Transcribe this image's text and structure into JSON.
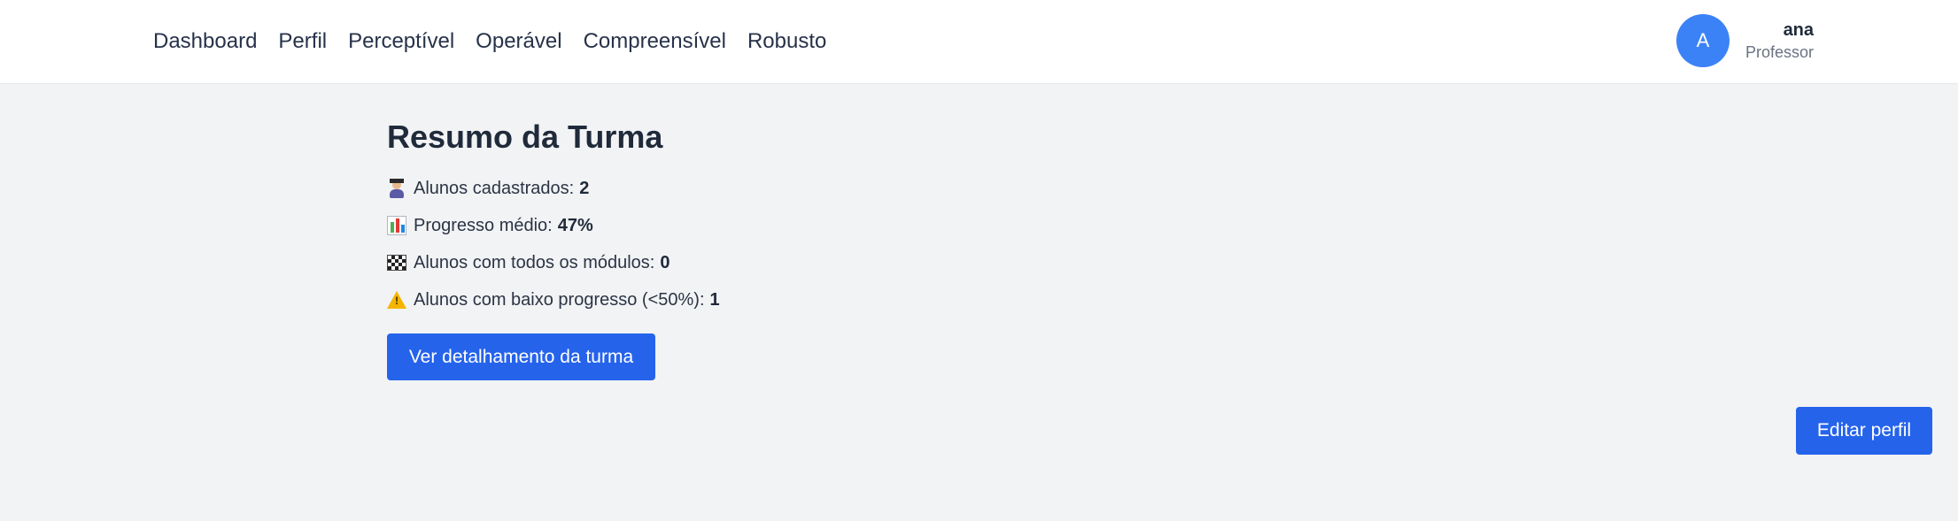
{
  "nav": {
    "items": [
      {
        "label": "Dashboard"
      },
      {
        "label": "Perfil"
      },
      {
        "label": "Perceptível"
      },
      {
        "label": "Operável"
      },
      {
        "label": "Compreensível"
      },
      {
        "label": "Robusto"
      }
    ]
  },
  "user": {
    "initial": "A",
    "name": "ana",
    "role": "Professor"
  },
  "summary": {
    "title": "Resumo da Turma",
    "stats": [
      {
        "icon": "student-icon",
        "label": "Alunos cadastrados:",
        "value": "2"
      },
      {
        "icon": "bar-chart-icon",
        "label": "Progresso médio:",
        "value": "47%"
      },
      {
        "icon": "checkered-flag-icon",
        "label": "Alunos com todos os módulos:",
        "value": "0"
      },
      {
        "icon": "warning-icon",
        "label": "Alunos com baixo progresso (<50%):",
        "value": "1"
      }
    ],
    "detail_button": "Ver detalhamento da turma"
  },
  "edit_profile_button": "Editar perfil",
  "colors": {
    "accent": "#2563eb",
    "avatar": "#3b82f6",
    "background": "#f2f3f5"
  }
}
